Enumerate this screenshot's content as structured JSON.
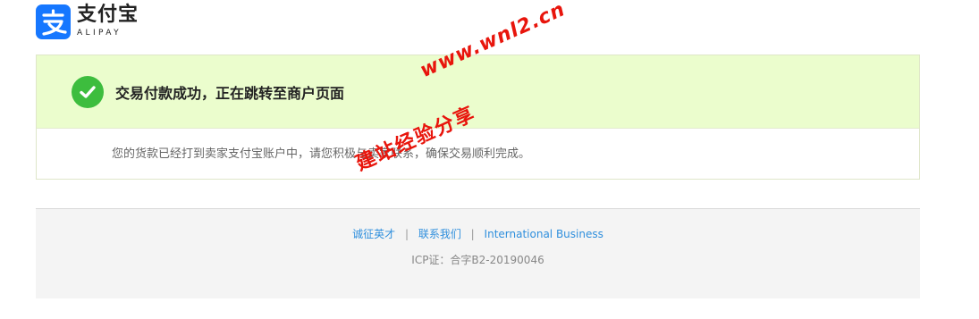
{
  "brand": {
    "name_cn": "支付宝",
    "name_en": "ALIPAY",
    "icon": "alipay-logo-icon",
    "color": "#1677ff"
  },
  "result": {
    "icon": "check-circle-icon",
    "title": "交易付款成功，正在跳转至商户页面",
    "message": "您的货款已经打到卖家支付宝账户中，请您积极与卖家联系，确保交易顺利完成。",
    "header_bg": "#ebfdcd",
    "success_color": "#3dbd3e"
  },
  "footer": {
    "links": [
      "诚征英才",
      "联系我们",
      "International Business"
    ],
    "separator": "|",
    "icp": "ICP证：合字B2-20190046",
    "link_color": "#2f8fdd"
  },
  "watermark": {
    "url": "www.wnl2.cn",
    "text": "建站经验分享",
    "color": "#e8150c"
  }
}
